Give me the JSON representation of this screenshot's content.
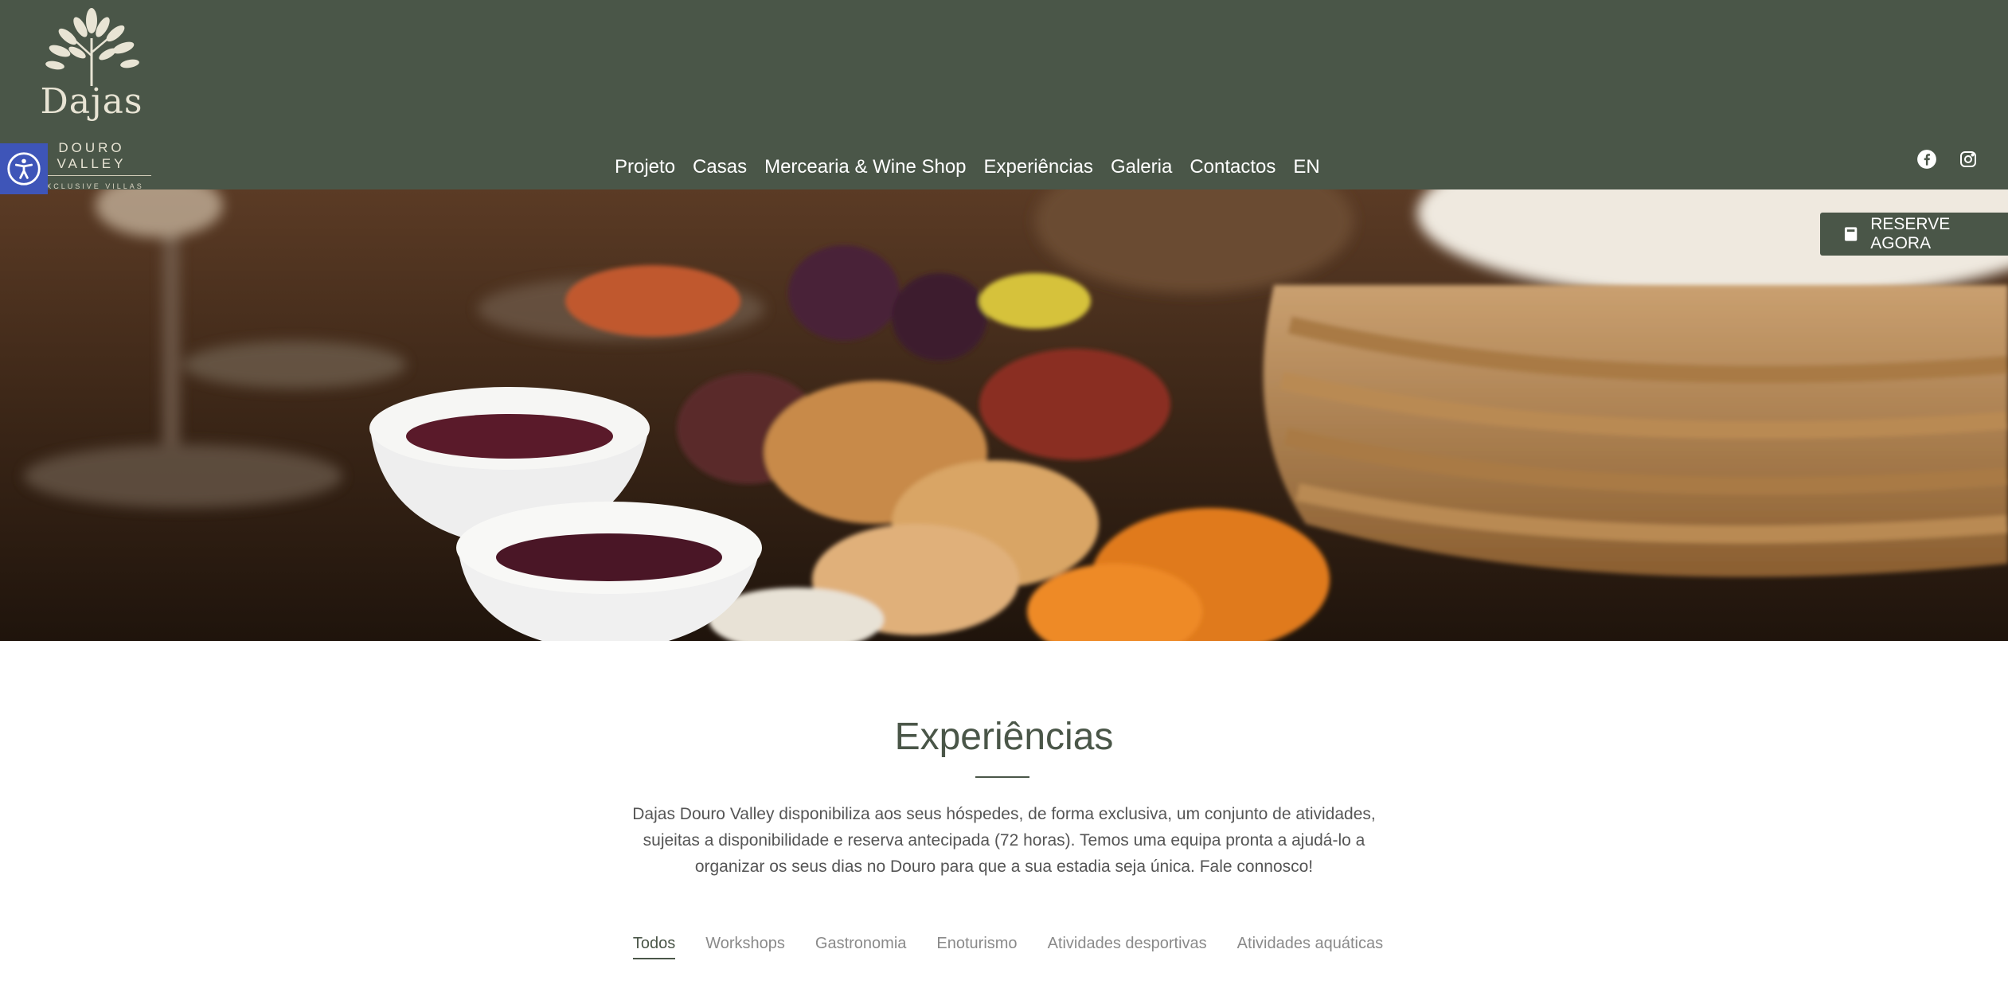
{
  "brand": {
    "name": "Dajas",
    "subtitle": "DOURO VALLEY",
    "tagline": "EXCLUSIVE VILLAS"
  },
  "nav": {
    "items": [
      {
        "label": "Projeto"
      },
      {
        "label": "Casas"
      },
      {
        "label": "Mercearia & Wine Shop"
      },
      {
        "label": "Experiências"
      },
      {
        "label": "Galeria"
      },
      {
        "label": "Contactos"
      },
      {
        "label": "EN"
      }
    ]
  },
  "social": {
    "facebook_icon": "facebook-icon",
    "instagram_icon": "instagram-icon"
  },
  "accessibility": {
    "icon": "accessibility-icon"
  },
  "cta": {
    "label": "RESERVE AGORA",
    "icon": "book-icon"
  },
  "content": {
    "title": "Experiências",
    "intro": "Dajas Douro Valley disponibiliza aos seus hóspedes, de forma exclusiva, um conjunto de atividades, sujeitas a disponibilidade e reserva antecipada (72 horas). Temos uma equipa pronta a ajudá-lo a organizar os seus dias no Douro para que a sua estadia seja única. Fale connosco!",
    "filters": [
      {
        "label": "Todos",
        "active": true
      },
      {
        "label": "Workshops"
      },
      {
        "label": "Gastronomia"
      },
      {
        "label": "Enoturismo"
      },
      {
        "label": "Atividades desportivas"
      },
      {
        "label": "Atividades aquáticas"
      }
    ]
  },
  "colors": {
    "header_bg": "#4a5648",
    "accent": "#4a5648",
    "accessibility_bg": "#3e55b8"
  }
}
